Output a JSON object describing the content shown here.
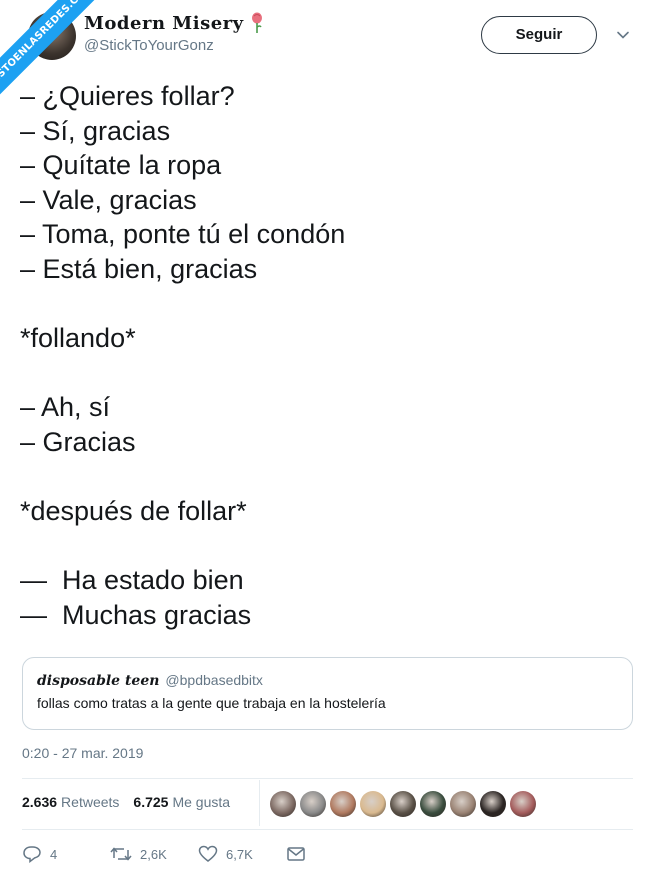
{
  "watermark": "VISTOENLASREDES.COM",
  "author": {
    "display_name": "Modern Misery",
    "handle": "@StickToYourGonz",
    "emoji_icon": "rose-icon"
  },
  "follow_label": "Seguir",
  "tweet_lines": [
    "– ¿Quieres follar?",
    "– Sí, gracias",
    "– Quítate la ropa",
    "– Vale, gracias",
    "– Toma, ponte tú el condón",
    "– Está bien, gracias",
    "",
    "*follando*",
    "",
    "– Ah, sí",
    "– Gracias",
    "",
    "*después de follar*",
    "",
    "—  Ha estado bien",
    "—  Muchas gracias"
  ],
  "quote": {
    "display_name": "disposable teen",
    "handle": "@bpdbasedbitx",
    "text": "follas como tratas a la gente que trabaja en la hostelería"
  },
  "timestamp": "0:20 - 27 mar. 2019",
  "stats": {
    "retweets_count": "2.636",
    "retweets_label": "Retweets",
    "likes_count": "6.725",
    "likes_label": "Me gusta"
  },
  "liker_avatar_colors": [
    "#7d6a63",
    "#8a8a8a",
    "#b07a60",
    "#d9b98f",
    "#5a5147",
    "#3a4d3e",
    "#9a8374",
    "#2b2523",
    "#a45c5c"
  ],
  "actions": {
    "replies": "4",
    "retweets": "2,6K",
    "likes": "6,7K"
  },
  "colors": {
    "accent": "#1da1f2",
    "text": "#14171a",
    "secondary": "#657786",
    "border": "#e6ecf0"
  }
}
